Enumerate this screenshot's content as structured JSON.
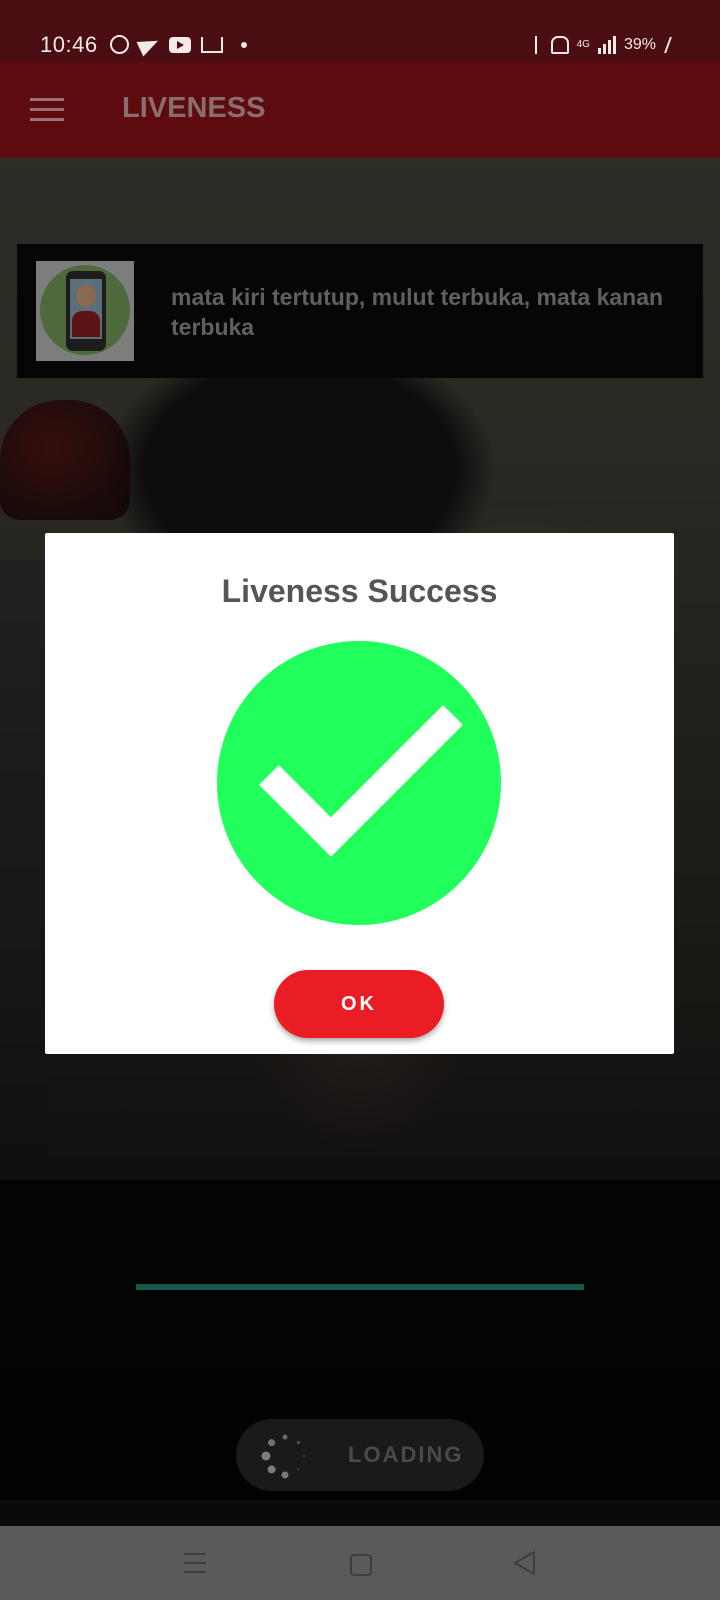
{
  "status_bar": {
    "time": "10:46",
    "battery": "39%",
    "network_label": "4G",
    "icons": [
      "whatsapp-icon",
      "telegram-icon",
      "youtube-icon",
      "gmail-icon",
      "bluetooth-icon",
      "bell-off-icon",
      "signal-icon",
      "charging-icon"
    ]
  },
  "app_bar": {
    "title": "LIVENESS",
    "menu_icon": "hamburger-menu-icon"
  },
  "instruction": {
    "text": "mata kiri tertutup, mulut terbuka, mata kanan terbuka",
    "image_icon": "phone-selfie-illustration"
  },
  "dialog": {
    "title": "Liveness Success",
    "icon": "check-circle-icon",
    "icon_color": "#21ff5c",
    "button_label": "OK",
    "button_color": "#ea1c24"
  },
  "progress": {
    "value": 1.0,
    "color": "#17584d"
  },
  "loading": {
    "label": "LOADING",
    "icon": "spinner-icon"
  },
  "nav_bar": {
    "icons": [
      "recents-icon",
      "home-icon",
      "back-icon"
    ]
  }
}
